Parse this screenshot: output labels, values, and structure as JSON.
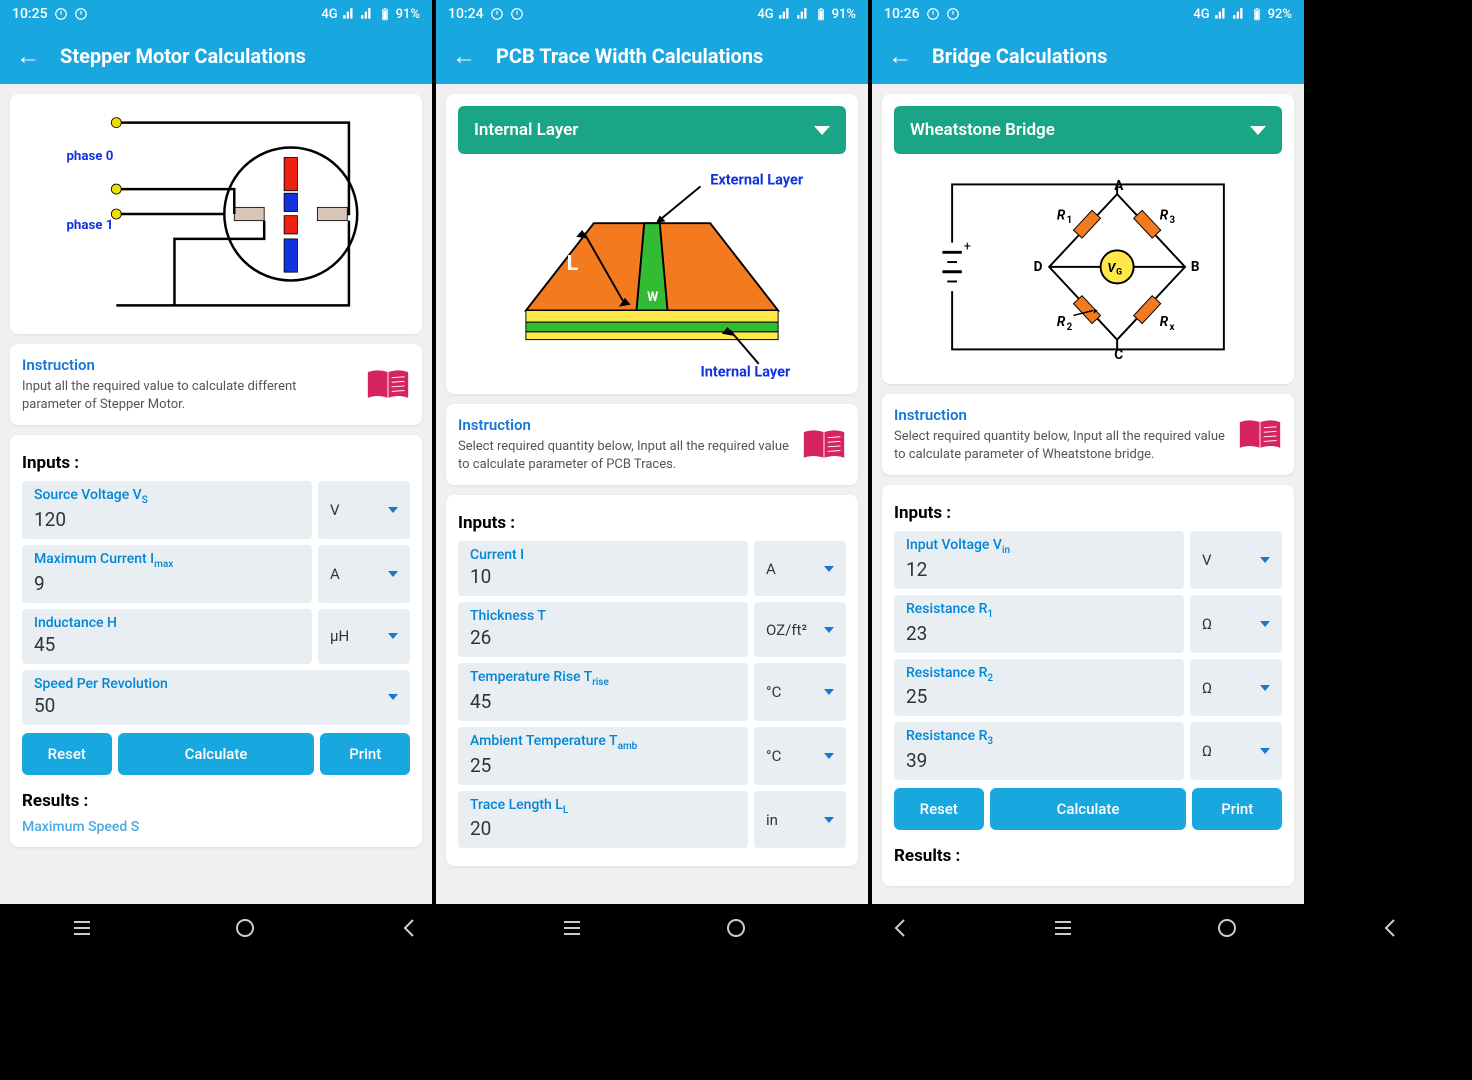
{
  "s1": {
    "status": {
      "time": "10:25",
      "net": "4G",
      "batt": "91%"
    },
    "title": "Stepper Motor Calculations",
    "instruction": {
      "heading": "Instruction",
      "body": "Input all the required value to calculate different parameter of Stepper Motor."
    },
    "inputs_title": "Inputs :",
    "inputs": [
      {
        "label": "Source Voltage V",
        "sub": "S",
        "value": "120",
        "unit": "V"
      },
      {
        "label": "Maximum Current I",
        "sub": "max",
        "value": "9",
        "unit": "A"
      },
      {
        "label": "Inductance H",
        "sub": "",
        "value": "45",
        "unit": "μH"
      },
      {
        "label": "Speed Per Revolution",
        "sub": "",
        "value": "50",
        "unit": ""
      }
    ],
    "buttons": {
      "reset": "Reset",
      "calc": "Calculate",
      "print": "Print"
    },
    "results_title": "Results :",
    "result_peek": "Maximum Speed S"
  },
  "s2": {
    "status": {
      "time": "10:24",
      "net": "4G",
      "batt": "91%"
    },
    "title": "PCB Trace Width Calculations",
    "selector": "Internal Layer",
    "diagram_labels": {
      "ext": "External Layer",
      "int": "Internal Layer",
      "L": "L",
      "W": "W"
    },
    "instruction": {
      "heading": "Instruction",
      "body": "Select required quantity below, Input all the required value to calculate parameter of PCB Traces."
    },
    "inputs_title": "Inputs :",
    "inputs": [
      {
        "label": "Current I",
        "sub": "",
        "value": "10",
        "unit": "A"
      },
      {
        "label": "Thickness T",
        "sub": "",
        "value": "26",
        "unit": "OZ/ft²"
      },
      {
        "label": "Temperature Rise T",
        "sub": "rise",
        "value": "45",
        "unit": "°C"
      },
      {
        "label": "Ambient Temperature T",
        "sub": "amb",
        "value": "25",
        "unit": "°C"
      },
      {
        "label": "Trace Length L",
        "sub": "L",
        "value": "20",
        "unit": "in"
      }
    ]
  },
  "s3": {
    "status": {
      "time": "10:26",
      "net": "4G",
      "batt": "92%"
    },
    "title": "Bridge Calculations",
    "selector": "Wheatstone Bridge",
    "instruction": {
      "heading": "Instruction",
      "body": "Select required quantity below, Input all the required value to calculate parameter of Wheatstone bridge."
    },
    "inputs_title": "Inputs :",
    "inputs": [
      {
        "label": "Input Voltage V",
        "sub": "in",
        "value": "12",
        "unit": "V"
      },
      {
        "label": "Resistance R",
        "sub": "1",
        "value": "23",
        "unit": "Ω"
      },
      {
        "label": "Resistance R",
        "sub": "2",
        "value": "25",
        "unit": "Ω"
      },
      {
        "label": "Resistance R",
        "sub": "3",
        "value": "39",
        "unit": "Ω"
      }
    ],
    "buttons": {
      "reset": "Reset",
      "calc": "Calculate",
      "print": "Print"
    },
    "results_title": "Results :"
  }
}
